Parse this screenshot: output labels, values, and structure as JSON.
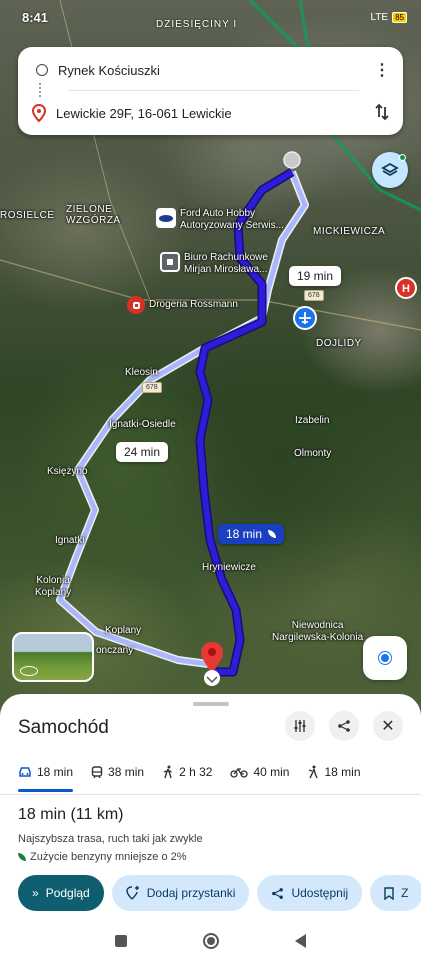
{
  "status_bar": {
    "time": "8:41",
    "signal": "LTE",
    "battery": "85",
    "street_label": "DZIESIĘCINY I"
  },
  "search": {
    "origin": "Rynek Kościuszki",
    "destination": "Lewickie 29F, 16-061 Lewickie",
    "more_icon": "more-vert-icon",
    "swap_icon": "swap-icon"
  },
  "map": {
    "labels": {
      "zielone_wzgorza": "ZIELONE\nWZGÓRZA",
      "rosielce": "ROSIELCE",
      "mickiewicza": "MICKIEWICZA",
      "dojlidy": "DOJLIDY",
      "kleosin": "Kleosin",
      "ignatki_osiedle": "Ignatki-Osiedle",
      "izabelin": "Izabelin",
      "olmonty": "Olmonty",
      "ksiezyno": "Księżyno",
      "ignatki": "Ignatki",
      "kolonia_koplany": "Kolonia\nKoplany",
      "hryniewicze": "Hryniewicze",
      "koplany": "Koplany",
      "onczany": "onczany",
      "niewodnica": "Niewodnica\nNargilewska-Kolonia"
    },
    "pois": {
      "ford": "Ford Auto Hobby\nAutoryzowany Serwis...",
      "biuro": "Biuro Rachunkowe\nMirjan Mirosława...",
      "rossmann": "Drogeria Rossmann"
    },
    "road_shields": [
      "678",
      "678"
    ],
    "route_bubbles": {
      "alt1": "19 min",
      "alt2": "24 min",
      "main": "18 min"
    }
  },
  "sheet": {
    "title": "Samochód",
    "modes": [
      {
        "icon": "car-icon",
        "label": "18 min"
      },
      {
        "icon": "transit-icon",
        "label": "38 min"
      },
      {
        "icon": "walk-icon",
        "label": "2 h 32"
      },
      {
        "icon": "bike-icon",
        "label": "40 min"
      },
      {
        "icon": "ride-icon",
        "label": "18 min"
      }
    ],
    "summary": "18 min (11 km)",
    "route_desc": "Najszybsza trasa, ruch taki jak zwykle",
    "eco_note": "Zużycie benzyny mniejsze o 2%",
    "actions": {
      "preview": "Podgląd",
      "add_stops": "Dodaj przystanki",
      "share": "Udostępnij",
      "save": "Z"
    }
  },
  "colors": {
    "route_main": "#2c1ed6",
    "route_alt": "#a9b7ff",
    "accent_teal": "#0e5e6f",
    "chip_blue": "#d3e8fb"
  }
}
